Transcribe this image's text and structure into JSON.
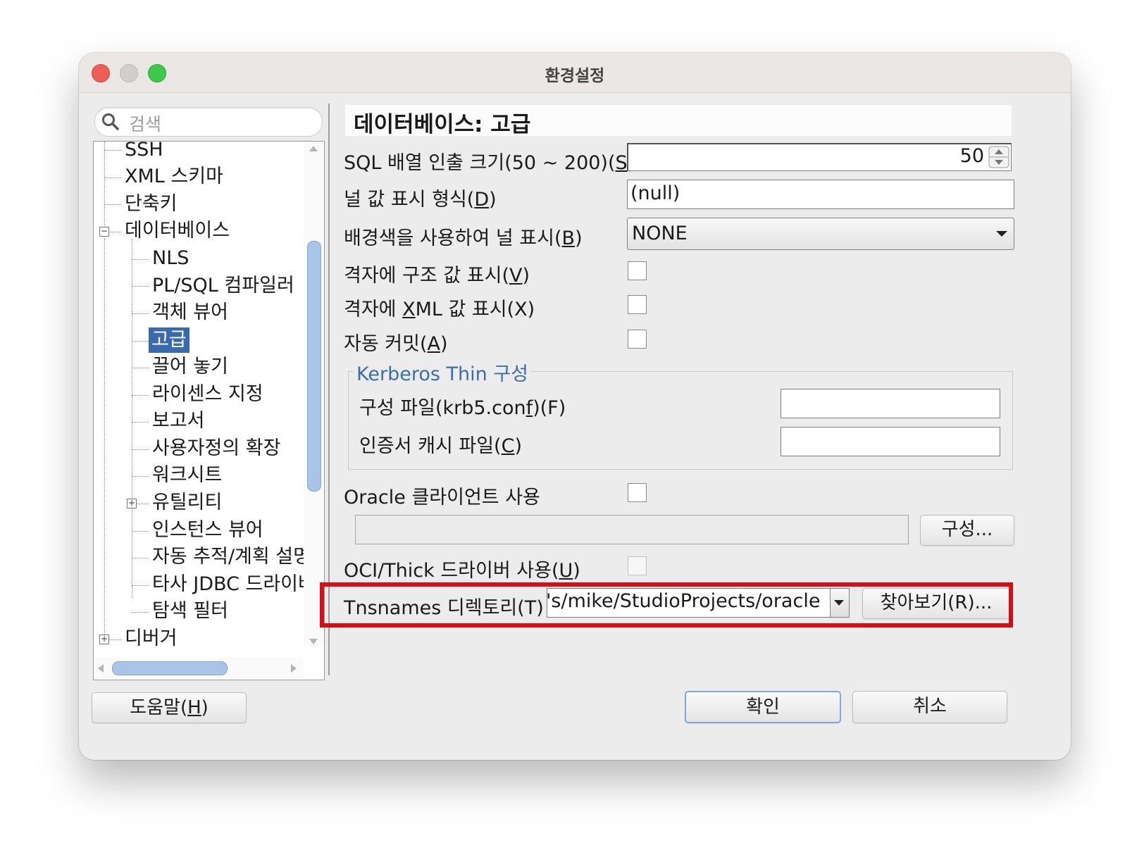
{
  "window": {
    "title": "환경설정"
  },
  "search": {
    "placeholder": "검색"
  },
  "tree": {
    "items": [
      {
        "label": "SSH"
      },
      {
        "label": "XML 스키마"
      },
      {
        "label": "단축키"
      },
      {
        "label": "데이터베이스"
      },
      {
        "label": "NLS"
      },
      {
        "label": "PL/SQL 컴파일러"
      },
      {
        "label": "객체 뷰어"
      },
      {
        "label": "고급"
      },
      {
        "label": "끌어 놓기"
      },
      {
        "label": "라이센스 지정"
      },
      {
        "label": "보고서"
      },
      {
        "label": "사용자정의 확장"
      },
      {
        "label": "워크시트"
      },
      {
        "label": "유틸리티"
      },
      {
        "label": "인스턴스 뷰어"
      },
      {
        "label": "자동 추적/계획 설명"
      },
      {
        "label": "타사 JDBC 드라이버"
      },
      {
        "label": "탐색 필터"
      },
      {
        "label": "디버거"
      }
    ],
    "selected": "고급"
  },
  "panel": {
    "title": "데이터베이스: 고급",
    "sql_fetch": {
      "label_pre": "SQL 배열 인출 크기(50 ~ 200)(",
      "mnemonic": "S",
      "label_post": ")",
      "value": "50"
    },
    "null_display": {
      "label_pre": "널 값 표시 형식(",
      "mnemonic": "D",
      "label_post": ")",
      "value": "(null)"
    },
    "bg_null": {
      "label_pre": "배경색을 사용하여 널 표시(",
      "mnemonic": "B",
      "label_post": ")",
      "value": "NONE"
    },
    "grid_struct": {
      "label_pre": "격자에 구조 값 표시(",
      "mnemonic": "V",
      "label_post": ")",
      "checked": false
    },
    "grid_xml": {
      "label_pre": "격자에 ",
      "mnemonic": "X",
      "label_post": "ML 값 표시(X)",
      "checked": false
    },
    "autocommit": {
      "label_pre": "자동 커밋(",
      "mnemonic": "A",
      "label_post": ")",
      "checked": false
    },
    "kerberos": {
      "title": "Kerberos Thin 구성",
      "config_file": {
        "label_pre": "구성 파일(krb5.con",
        "mnemonic": "f",
        "label_post": ")(F)",
        "value": ""
      },
      "cache_file": {
        "label_pre": "인증서 캐시 파일(",
        "mnemonic": "C",
        "label_post": ")",
        "value": ""
      }
    },
    "oracle_client": {
      "label": "Oracle 클라이언트 사용",
      "checked": false,
      "path": "",
      "config_button": "구성..."
    },
    "oci_thick": {
      "label_pre": "OCI/Thick 드라이버 사용(",
      "mnemonic": "U",
      "label_post": ")",
      "checked": false
    },
    "tnsnames": {
      "label": "Tnsnames 디렉토리(T)",
      "value": "'s/mike/StudioProjects/oracle",
      "browse_button": "찾아보기(R)..."
    }
  },
  "footer": {
    "help_pre": "도움말(",
    "help_mnemonic": "H",
    "help_post": ")",
    "ok": "확인",
    "cancel": "취소"
  },
  "colors": {
    "selection": "#3a6aae",
    "highlight_box": "#d90c12",
    "group_title": "#3c6ea8"
  }
}
